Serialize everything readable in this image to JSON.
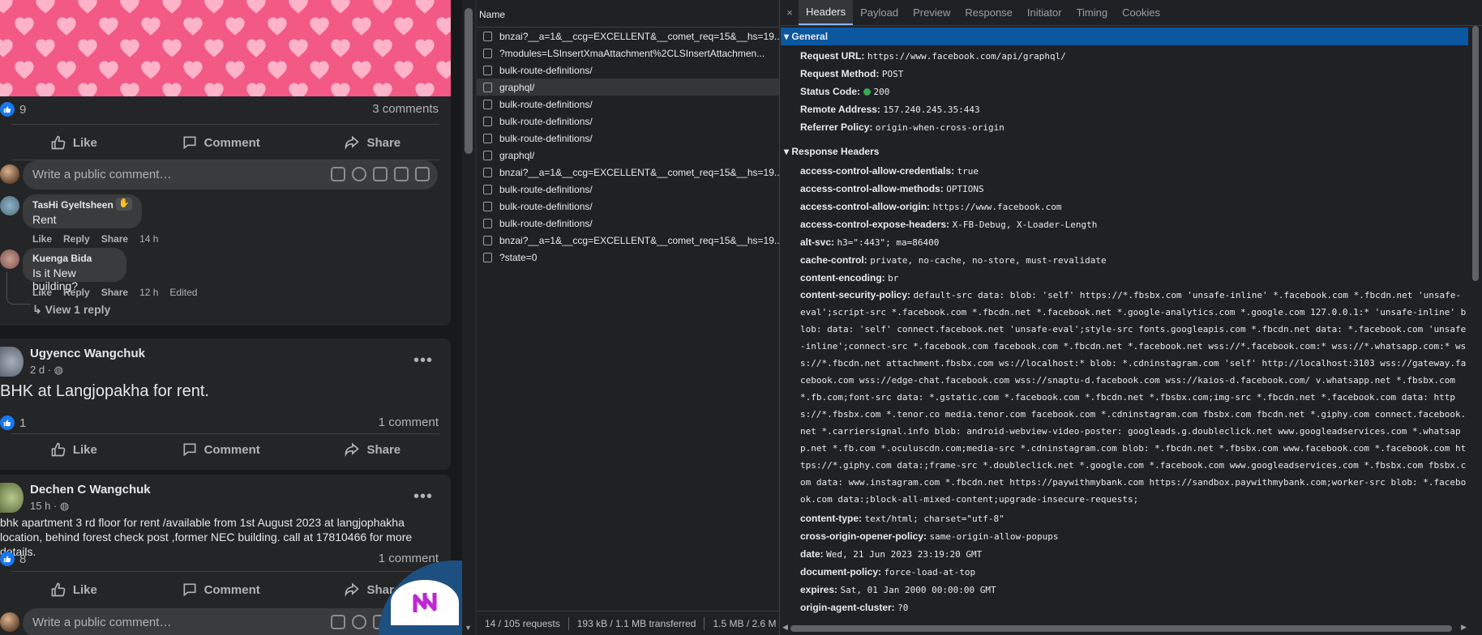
{
  "feed": {
    "post1": {
      "like_count": "9",
      "comment_count": "3 comments",
      "actions": {
        "like": "Like",
        "comment": "Comment",
        "share": "Share"
      },
      "comment_placeholder": "Write a public comment…",
      "comments": [
        {
          "name": "TasHi Gyeltsheen",
          "text": "Rent",
          "reply": "Reply",
          "like": "Like",
          "share": "Share",
          "time": "14 h"
        },
        {
          "name": "Kuenga Bida",
          "text": "Is it New building?",
          "reply": "Reply",
          "like": "Like",
          "share": "Share",
          "time": "12 h",
          "edited": "Edited"
        }
      ],
      "view_reply": "View 1 reply"
    },
    "post2": {
      "author": "Ugyencc Wangchuk",
      "time": "2 d ·",
      "text": "BHK at Langjopakha for rent.",
      "like_count": "1",
      "comment_count": "1 comment",
      "actions": {
        "like": "Like",
        "comment": "Comment",
        "share": "Share"
      }
    },
    "post3": {
      "author": "Dechen C Wangchuk",
      "time": "15 h ·",
      "text": "bhk apartment 3 rd floor for rent /available from 1st August 2023 at langjophakha location, behind forest check post ,former NEC building. call at 17810466 for more details.",
      "like_count": "8",
      "comment_count": "1 comment",
      "actions": {
        "like": "Like",
        "comment": "Comment",
        "share": "Share"
      },
      "comment_placeholder": "Write a public comment…"
    },
    "colors": {
      "background": "#18191a",
      "card": "#242526",
      "hearts_bg": "#f25a85",
      "heart": "#ffb3c8",
      "like_blue": "#1877f2"
    }
  },
  "network": {
    "list_header": "Name",
    "requests": [
      "bnzai?__a=1&__ccg=EXCELLENT&__comet_req=15&__hs=19...",
      "?modules=LSInsertXmaAttachment%2CLSInsertAttachmen...",
      "bulk-route-definitions/",
      "graphql/",
      "bulk-route-definitions/",
      "bulk-route-definitions/",
      "bulk-route-definitions/",
      "graphql/",
      "bnzai?__a=1&__ccg=EXCELLENT&__comet_req=15&__hs=19...",
      "bulk-route-definitions/",
      "bulk-route-definitions/",
      "bulk-route-definitions/",
      "bnzai?__a=1&__ccg=EXCELLENT&__comet_req=15&__hs=19...",
      "?state=0"
    ],
    "selected_index": 3,
    "status": {
      "requests": "14 / 105 requests",
      "transferred": "193 kB / 1.1 MB transferred",
      "resources": "1.5 MB / 2.6 M"
    }
  },
  "detail": {
    "close": "×",
    "tabs": [
      "Headers",
      "Payload",
      "Preview",
      "Response",
      "Initiator",
      "Timing",
      "Cookies"
    ],
    "active_tab": "Headers",
    "general_title": "General",
    "general": [
      {
        "k": "Request URL:",
        "v": "https://www.facebook.com/api/graphql/"
      },
      {
        "k": "Request Method:",
        "v": "POST"
      },
      {
        "k": "Status Code:",
        "v": "200"
      },
      {
        "k": "Remote Address:",
        "v": "157.240.245.35:443"
      },
      {
        "k": "Referrer Policy:",
        "v": "origin-when-cross-origin"
      }
    ],
    "response_title": "Response Headers",
    "response": [
      {
        "k": "access-control-allow-credentials:",
        "v": "true"
      },
      {
        "k": "access-control-allow-methods:",
        "v": "OPTIONS"
      },
      {
        "k": "access-control-allow-origin:",
        "v": "https://www.facebook.com"
      },
      {
        "k": "access-control-expose-headers:",
        "v": "X-FB-Debug, X-Loader-Length"
      },
      {
        "k": "alt-svc:",
        "v": "h3=\":443\"; ma=86400"
      },
      {
        "k": "cache-control:",
        "v": "private, no-cache, no-store, must-revalidate"
      },
      {
        "k": "content-encoding:",
        "v": "br"
      }
    ],
    "csp": {
      "k": "content-security-policy:",
      "lines": [
        "default-src data: blob: 'self' https://*.fbsbx.com 'unsafe-inline' *.facebook.com *.fbcdn.net 'unsafe-",
        "eval';script-src *.facebook.com *.fbcdn.net *.facebook.net *.google-analytics.com *.google.com 127.0.0.1:* 'unsafe-inline' b",
        "lob: data: 'self' connect.facebook.net 'unsafe-eval';style-src fonts.googleapis.com *.fbcdn.net data: *.facebook.com 'unsafe",
        "-inline';connect-src *.facebook.com facebook.com *.fbcdn.net *.facebook.net wss://*.facebook.com:* wss://*.whatsapp.com:* ws",
        "s://*.fbcdn.net attachment.fbsbx.com ws://localhost:* blob: *.cdninstagram.com 'self' http://localhost:3103 wss://gateway.fa",
        "cebook.com wss://edge-chat.facebook.com wss://snaptu-d.facebook.com wss://kaios-d.facebook.com/ v.whatsapp.net *.fbsbx.com",
        "*.fb.com;font-src data: *.gstatic.com *.facebook.com *.fbcdn.net *.fbsbx.com;img-src *.fbcdn.net *.facebook.com data: http",
        "s://*.fbsbx.com *.tenor.co media.tenor.com facebook.com *.cdninstagram.com fbsbx.com fbcdn.net *.giphy.com connect.facebook.",
        "net *.carriersignal.info blob: android-webview-video-poster: googleads.g.doubleclick.net www.googleadservices.com *.whatsap",
        "p.net *.fb.com *.oculuscdn.com;media-src *.cdninstagram.com blob: *.fbcdn.net *.fbsbx.com www.facebook.com *.facebook.com ht",
        "tps://*.giphy.com data:;frame-src *.doubleclick.net *.google.com *.facebook.com www.googleadservices.com *.fbsbx.com fbsbx.c",
        "om data: www.instagram.com *.fbcdn.net https://paywithmybank.com https://sandbox.paywithmybank.com;worker-src blob: *.facebo",
        "ok.com data:;block-all-mixed-content;upgrade-insecure-requests;"
      ]
    },
    "response2": [
      {
        "k": "content-type:",
        "v": "text/html; charset=\"utf-8\""
      },
      {
        "k": "cross-origin-opener-policy:",
        "v": "same-origin-allow-popups"
      },
      {
        "k": "date:",
        "v": "Wed, 21 Jun 2023 23:19:20 GMT"
      },
      {
        "k": "document-policy:",
        "v": "force-load-at-top"
      },
      {
        "k": "expires:",
        "v": "Sat, 01 Jan 2000 00:00:00 GMT"
      },
      {
        "k": "origin-agent-cluster:",
        "v": "?0"
      }
    ],
    "colors": {
      "panel": "#202124",
      "selected_section": "#0b57a0",
      "status_ok": "#34a853",
      "active_tab_underline": "#8ab4f8"
    }
  }
}
